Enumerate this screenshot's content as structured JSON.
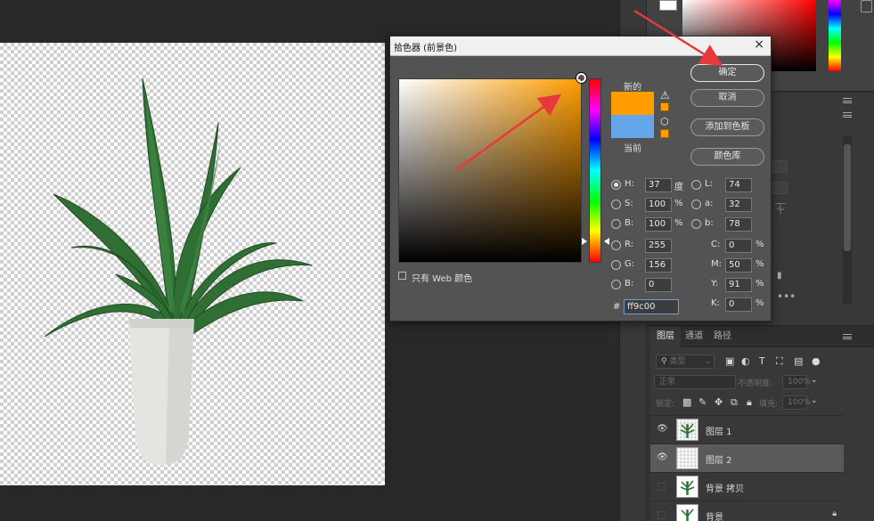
{
  "dialog": {
    "title": "拾色器 (前景色)",
    "close": "×",
    "new_label": "新的",
    "current_label": "当前",
    "new_color": "#ff9c00",
    "current_color": "#64a6e9",
    "buttons": {
      "ok": "确定",
      "cancel": "取消",
      "add_swatch": "添加到色板",
      "color_library": "颜色库"
    },
    "web_only_label": "只有 Web 颜色",
    "fields": {
      "H": {
        "label": "H:",
        "value": "37",
        "unit": "度",
        "selected": true
      },
      "S": {
        "label": "S:",
        "value": "100",
        "unit": "%"
      },
      "B": {
        "label": "B:",
        "value": "100",
        "unit": "%"
      },
      "R": {
        "label": "R:",
        "value": "255"
      },
      "G": {
        "label": "G:",
        "value": "156"
      },
      "B2": {
        "label": "B:",
        "value": "0"
      },
      "L": {
        "label": "L:",
        "value": "74"
      },
      "a": {
        "label": "a:",
        "value": "32"
      },
      "b": {
        "label": "b:",
        "value": "78"
      },
      "C": {
        "label": "C:",
        "value": "0",
        "unit": "%"
      },
      "M": {
        "label": "M:",
        "value": "50",
        "unit": "%"
      },
      "Y": {
        "label": "Y:",
        "value": "91",
        "unit": "%"
      },
      "K": {
        "label": "K:",
        "value": "0",
        "unit": "%"
      }
    },
    "hex_hash": "#",
    "hex_value": "ff9c00",
    "icons": {
      "warning": "warning-icon",
      "cube": "cube-icon"
    }
  },
  "layers_panel": {
    "tabs": [
      "图层",
      "通道",
      "路径"
    ],
    "filter_placeholder": "类型",
    "blend_mode": "正常",
    "opacity_label": "不透明度:",
    "opacity_value": "100%",
    "lock_label": "锁定:",
    "fill_label": "填充:",
    "fill_value": "100%",
    "layers": [
      {
        "name": "图层 1",
        "visible": true,
        "selected": false
      },
      {
        "name": "图层 2",
        "visible": true,
        "selected": true
      },
      {
        "name": "背景 拷贝",
        "visible": false,
        "selected": false
      },
      {
        "name": "背景",
        "visible": false,
        "selected": false,
        "locked": true
      }
    ]
  },
  "colors": {
    "accent_arrow": "#e8393d",
    "dialog_bg": "#535353",
    "workspace_bg": "#282828"
  }
}
